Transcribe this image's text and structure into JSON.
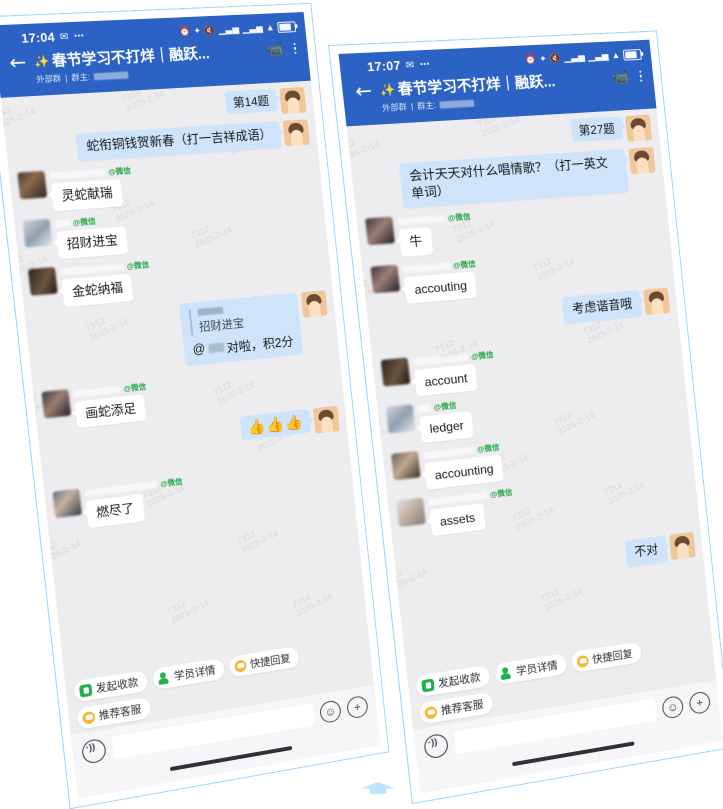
{
  "meta": {
    "accent_blue": "#2b62c4",
    "bubble_blue": "#cfe4fb",
    "chat_bg": "#ededf0",
    "frame_border": "#9fd4f7",
    "wechat_green": "#29a745",
    "watermark_line1": "7312",
    "watermark_line2": "2025-2-14"
  },
  "phones": [
    {
      "id": "left",
      "status": {
        "time": "17:04",
        "dots": "⋯"
      },
      "header": {
        "back_icon": "back-arrow-icon",
        "sparkle": "✨",
        "title": "春节学习不打烊｜融跃...",
        "tag": "外部群",
        "owner_label": "群主:",
        "video_icon": "video-call-icon",
        "more_icon": "more-options-icon"
      },
      "question_badge": "第14题",
      "messages": [
        {
          "side": "out",
          "type": "text",
          "text": "蛇衔铜钱贺新春（打一吉祥成语）"
        },
        {
          "side": "in",
          "type": "text",
          "avatar": "a1",
          "source": "@微信",
          "text": "灵蛇献瑞"
        },
        {
          "side": "in",
          "type": "text",
          "avatar": "a2",
          "source": "@微信",
          "text": "招财进宝"
        },
        {
          "side": "in",
          "type": "text",
          "avatar": "a3",
          "source": "@微信",
          "text": "金蛇纳福"
        },
        {
          "side": "out",
          "type": "quote",
          "quoted_text": "招财进宝",
          "reply_prefix": "@",
          "reply_text": "对啦，积2分"
        },
        {
          "side": "in",
          "type": "text",
          "avatar": "a4",
          "source": "@微信",
          "text": "画蛇添足"
        },
        {
          "side": "out",
          "type": "emoji",
          "text": "👍👍👍"
        },
        {
          "side": "in",
          "type": "text",
          "avatar": "a5",
          "source": "@微信",
          "text": "燃尽了"
        }
      ],
      "chips": [
        {
          "label": "发起收款",
          "icon": "shield-money-icon",
          "style": "green"
        },
        {
          "label": "学员详情",
          "icon": "student-profile-icon",
          "style": "person"
        },
        {
          "label": "快捷回复",
          "icon": "quick-reply-icon",
          "style": "orange"
        },
        {
          "label": "推荐客服",
          "icon": "recommend-service-icon",
          "style": "orange"
        }
      ],
      "input": {
        "voice_icon": "voice-record-icon",
        "placeholder": "",
        "value": "",
        "emoji_icon": "☺",
        "plus_icon": "+"
      }
    },
    {
      "id": "right",
      "status": {
        "time": "17:07",
        "dots": "⋯"
      },
      "header": {
        "back_icon": "back-arrow-icon",
        "sparkle": "✨",
        "title": "春节学习不打烊｜融跃...",
        "tag": "外部群",
        "owner_label": "群主:",
        "video_icon": "video-call-icon",
        "more_icon": "more-options-icon"
      },
      "question_badge": "第27题",
      "messages": [
        {
          "side": "out",
          "type": "text",
          "text": "会计天天对什么唱情歌？（打一英文单词）"
        },
        {
          "side": "in",
          "type": "text",
          "avatar": "a4",
          "source": "@微信",
          "text": "牛"
        },
        {
          "side": "in",
          "type": "text",
          "avatar": "a4",
          "source": "@微信",
          "text": "accouting"
        },
        {
          "side": "out",
          "type": "text",
          "text": "考虑谐音哦"
        },
        {
          "side": "in",
          "type": "text",
          "avatar": "a3",
          "source": "@微信",
          "text": "account"
        },
        {
          "side": "in",
          "type": "text",
          "avatar": "a2",
          "source": "@微信",
          "text": "ledger"
        },
        {
          "side": "in",
          "type": "text",
          "avatar": "a6",
          "source": "@微信",
          "text": "accounting"
        },
        {
          "side": "in",
          "type": "text",
          "avatar": "a7",
          "source": "@微信",
          "text": "assets"
        },
        {
          "side": "out",
          "type": "text",
          "text": "不对"
        }
      ],
      "chips": [
        {
          "label": "发起收款",
          "icon": "shield-money-icon",
          "style": "green"
        },
        {
          "label": "学员详情",
          "icon": "student-profile-icon",
          "style": "person"
        },
        {
          "label": "快捷回复",
          "icon": "quick-reply-icon",
          "style": "orange"
        },
        {
          "label": "推荐客服",
          "icon": "recommend-service-icon",
          "style": "orange"
        }
      ],
      "input": {
        "voice_icon": "voice-record-icon",
        "placeholder": "",
        "value": "",
        "emoji_icon": "☺",
        "plus_icon": "+"
      }
    }
  ]
}
